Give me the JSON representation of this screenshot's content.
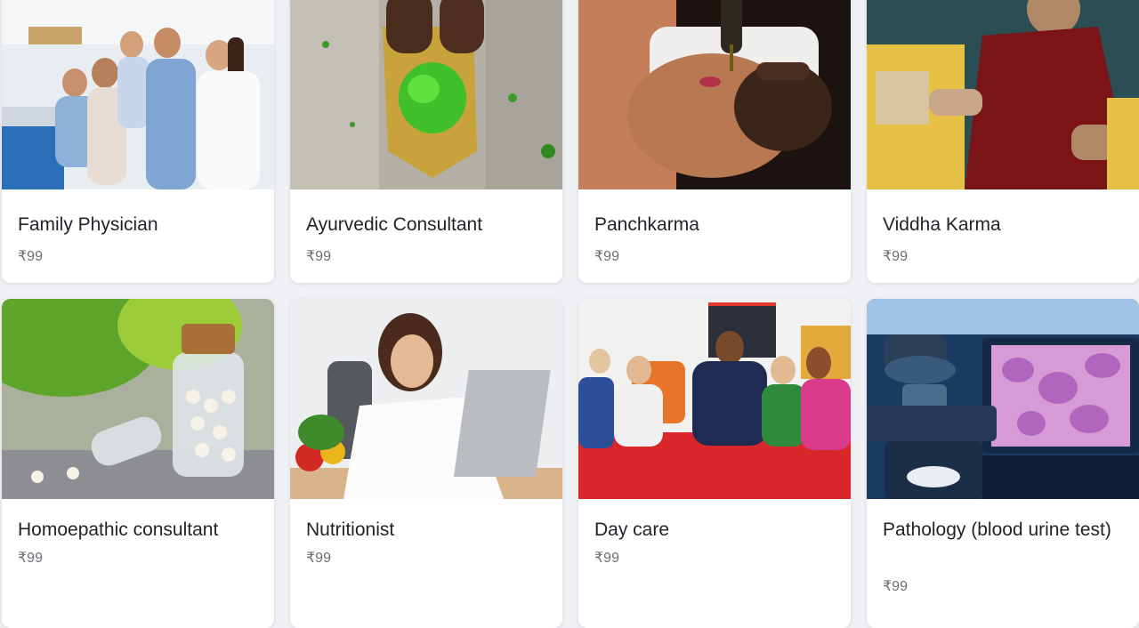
{
  "services": [
    {
      "name": "Family Physician",
      "price": "₹99",
      "image": "family-doctor-photo"
    },
    {
      "name": "Ayurvedic Consultant",
      "price": "₹99",
      "image": "herbs-grinding-photo"
    },
    {
      "name": "Panchkarma",
      "price": "₹99",
      "image": "oil-massage-photo"
    },
    {
      "name": "Viddha Karma",
      "price": "₹99",
      "image": "monk-ritual-photo"
    },
    {
      "name": "Homoepathic consultant",
      "price": "₹99",
      "image": "homeopathy-pills-photo"
    },
    {
      "name": "Nutritionist",
      "price": "₹99",
      "image": "nutritionist-laptop-photo"
    },
    {
      "name": "Day care",
      "price": "₹99",
      "image": "children-playing-photo"
    },
    {
      "name": "Pathology (blood urine test)",
      "price": "₹99",
      "image": "microscope-photo"
    }
  ]
}
